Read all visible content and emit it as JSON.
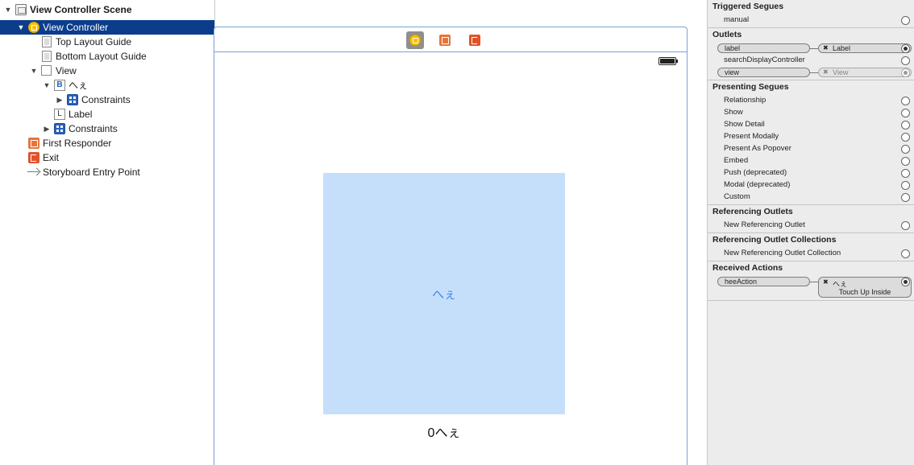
{
  "outline": {
    "items": [
      {
        "label": "View Controller Scene",
        "icon": "scene-icon"
      },
      {
        "label": "View Controller",
        "icon": "view-controller-icon"
      },
      {
        "label": "Top Layout Guide",
        "icon": "layout-guide-icon"
      },
      {
        "label": "Bottom Layout Guide",
        "icon": "layout-guide-icon"
      },
      {
        "label": "View",
        "icon": "view-icon"
      },
      {
        "label": "へぇ",
        "icon": "button-icon",
        "icon_glyph": "B"
      },
      {
        "label": "Constraints",
        "icon": "constraints-icon"
      },
      {
        "label": "Label",
        "icon": "label-icon",
        "icon_glyph": "L"
      },
      {
        "label": "Constraints",
        "icon": "constraints-icon"
      },
      {
        "label": "First Responder",
        "icon": "first-responder-icon"
      },
      {
        "label": "Exit",
        "icon": "exit-icon"
      },
      {
        "label": "Storyboard Entry Point",
        "icon": "entry-arrow-icon"
      }
    ]
  },
  "canvas": {
    "scene_bar_icons": [
      "view-controller-icon",
      "first-responder-icon",
      "exit-icon"
    ],
    "button_title": "へぇ",
    "label_text": "0へぇ"
  },
  "inspector": {
    "triggered_segues": {
      "title": "Triggered Segues",
      "items": [
        "manual"
      ]
    },
    "outlets": {
      "title": "Outlets",
      "items": [
        {
          "name": "label",
          "target": "Label",
          "connected": true
        },
        {
          "name": "searchDisplayController",
          "target": "",
          "connected": false
        },
        {
          "name": "view",
          "target": "View",
          "connected": true,
          "dimmed": true
        }
      ]
    },
    "presenting_segues": {
      "title": "Presenting Segues",
      "items": [
        "Relationship",
        "Show",
        "Show Detail",
        "Present Modally",
        "Present As Popover",
        "Embed",
        "Push (deprecated)",
        "Modal (deprecated)",
        "Custom"
      ]
    },
    "referencing_outlets": {
      "title": "Referencing Outlets",
      "items": [
        "New Referencing Outlet"
      ]
    },
    "referencing_outlet_collections": {
      "title": "Referencing Outlet Collections",
      "items": [
        "New Referencing Outlet Collection"
      ]
    },
    "received_actions": {
      "title": "Received Actions",
      "items": [
        {
          "name": "heeAction",
          "target": "へぇ",
          "event": "Touch Up Inside"
        }
      ]
    }
  }
}
